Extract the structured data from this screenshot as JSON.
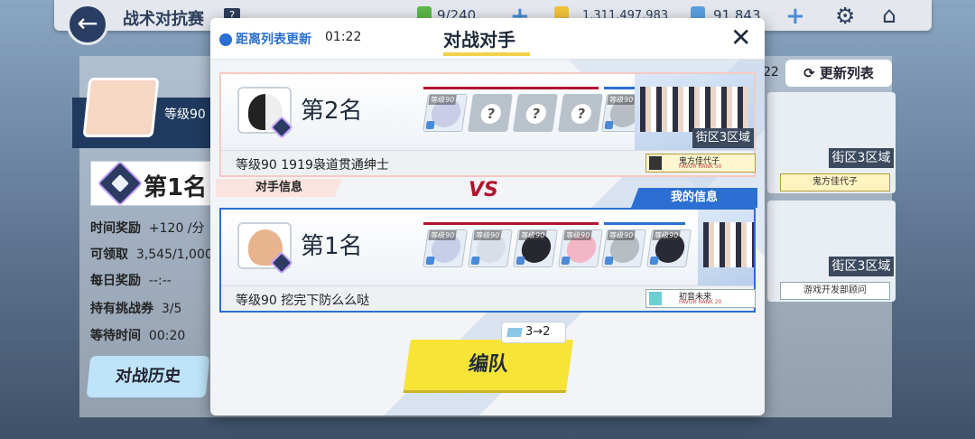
{
  "header": {
    "title": "战术对抗赛",
    "help": "?",
    "res1": "9/240",
    "res2": "1,311,497,983",
    "res3": "91,843",
    "back_icon": "back-arrow-icon",
    "settings_icon": "gear-icon",
    "home_icon": "home-icon"
  },
  "left": {
    "level": "等级90",
    "rank": "第1名",
    "rows": [
      {
        "label": "时间奖励",
        "value": "+120 /分"
      },
      {
        "label": "可领取",
        "value": "3,545/1,000"
      },
      {
        "label": "每日奖励",
        "value": "--:--"
      },
      {
        "label": "持有挑战券",
        "value": "3/5"
      },
      {
        "label": "等待时间",
        "value": "00:20"
      }
    ],
    "history": "对战历史"
  },
  "right": {
    "num": "22",
    "refresh": "更新列表",
    "cards": [
      {
        "district": "街区3区域",
        "tag": "鬼方佳代子"
      },
      {
        "district": "街区3区域",
        "tag": "游戏开发部顾问"
      }
    ]
  },
  "modal": {
    "timer_label": "距离列表更新",
    "timer": "01:22",
    "title": "对战对手",
    "close": "close-icon",
    "opponent": {
      "rank": "第2名",
      "level_name": "等级90 1919袅道贯通绅士",
      "district": "街区3区域",
      "tag_name": "鬼方佳代子",
      "tag_sub": "FAVOR RANK 50"
    },
    "opp_info": "对手信息",
    "vs": "VS",
    "my_info": "我的信息",
    "me": {
      "rank": "第1名",
      "level_name": "等级90 挖完下防么么哒",
      "tag_name": "初音未来",
      "tag_sub": "FAVOR RANK 20"
    },
    "form": "编队",
    "cost": "3→2",
    "slot_level": "等级90"
  },
  "colors": {
    "accent": "#2a6fd1",
    "button": "#f7e437",
    "vs": "#b0142d"
  }
}
